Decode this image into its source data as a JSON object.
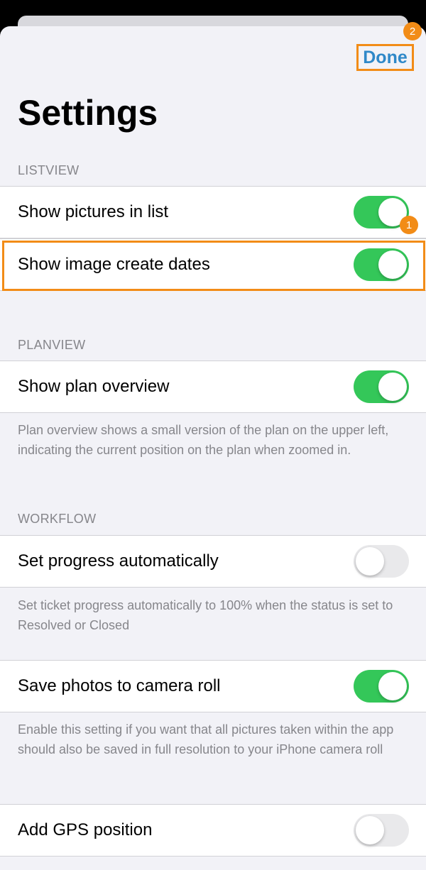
{
  "header": {
    "done_label": "Done",
    "title": "Settings"
  },
  "markers": {
    "first": "1",
    "second": "2"
  },
  "sections": {
    "listview": {
      "header": "LISTVIEW",
      "show_pictures": {
        "label": "Show pictures in list",
        "on": true
      },
      "show_dates": {
        "label": "Show image create dates",
        "on": true
      }
    },
    "planview": {
      "header": "PLANVIEW",
      "show_plan": {
        "label": "Show plan overview",
        "on": true
      },
      "footer": "Plan overview shows a small version of the plan on the upper left, indicating the current position on the plan when zoomed in."
    },
    "workflow": {
      "header": "WORKFLOW",
      "set_progress": {
        "label": "Set progress automatically",
        "on": false
      },
      "footer": "Set ticket progress automatically to 100% when the status is set to Resolved or Closed"
    },
    "photos": {
      "save_photos": {
        "label": "Save photos to camera roll",
        "on": true
      },
      "footer": "Enable this setting if you want that all pictures taken within the app should also be saved in full resolution to your iPhone camera roll"
    },
    "gps": {
      "add_gps": {
        "label": "Add GPS position",
        "on": false
      }
    }
  },
  "colors": {
    "accent": "#2f88c8",
    "toggle_on": "#34c759",
    "toggle_off": "#e9e9eb",
    "highlight": "#f28c17"
  }
}
